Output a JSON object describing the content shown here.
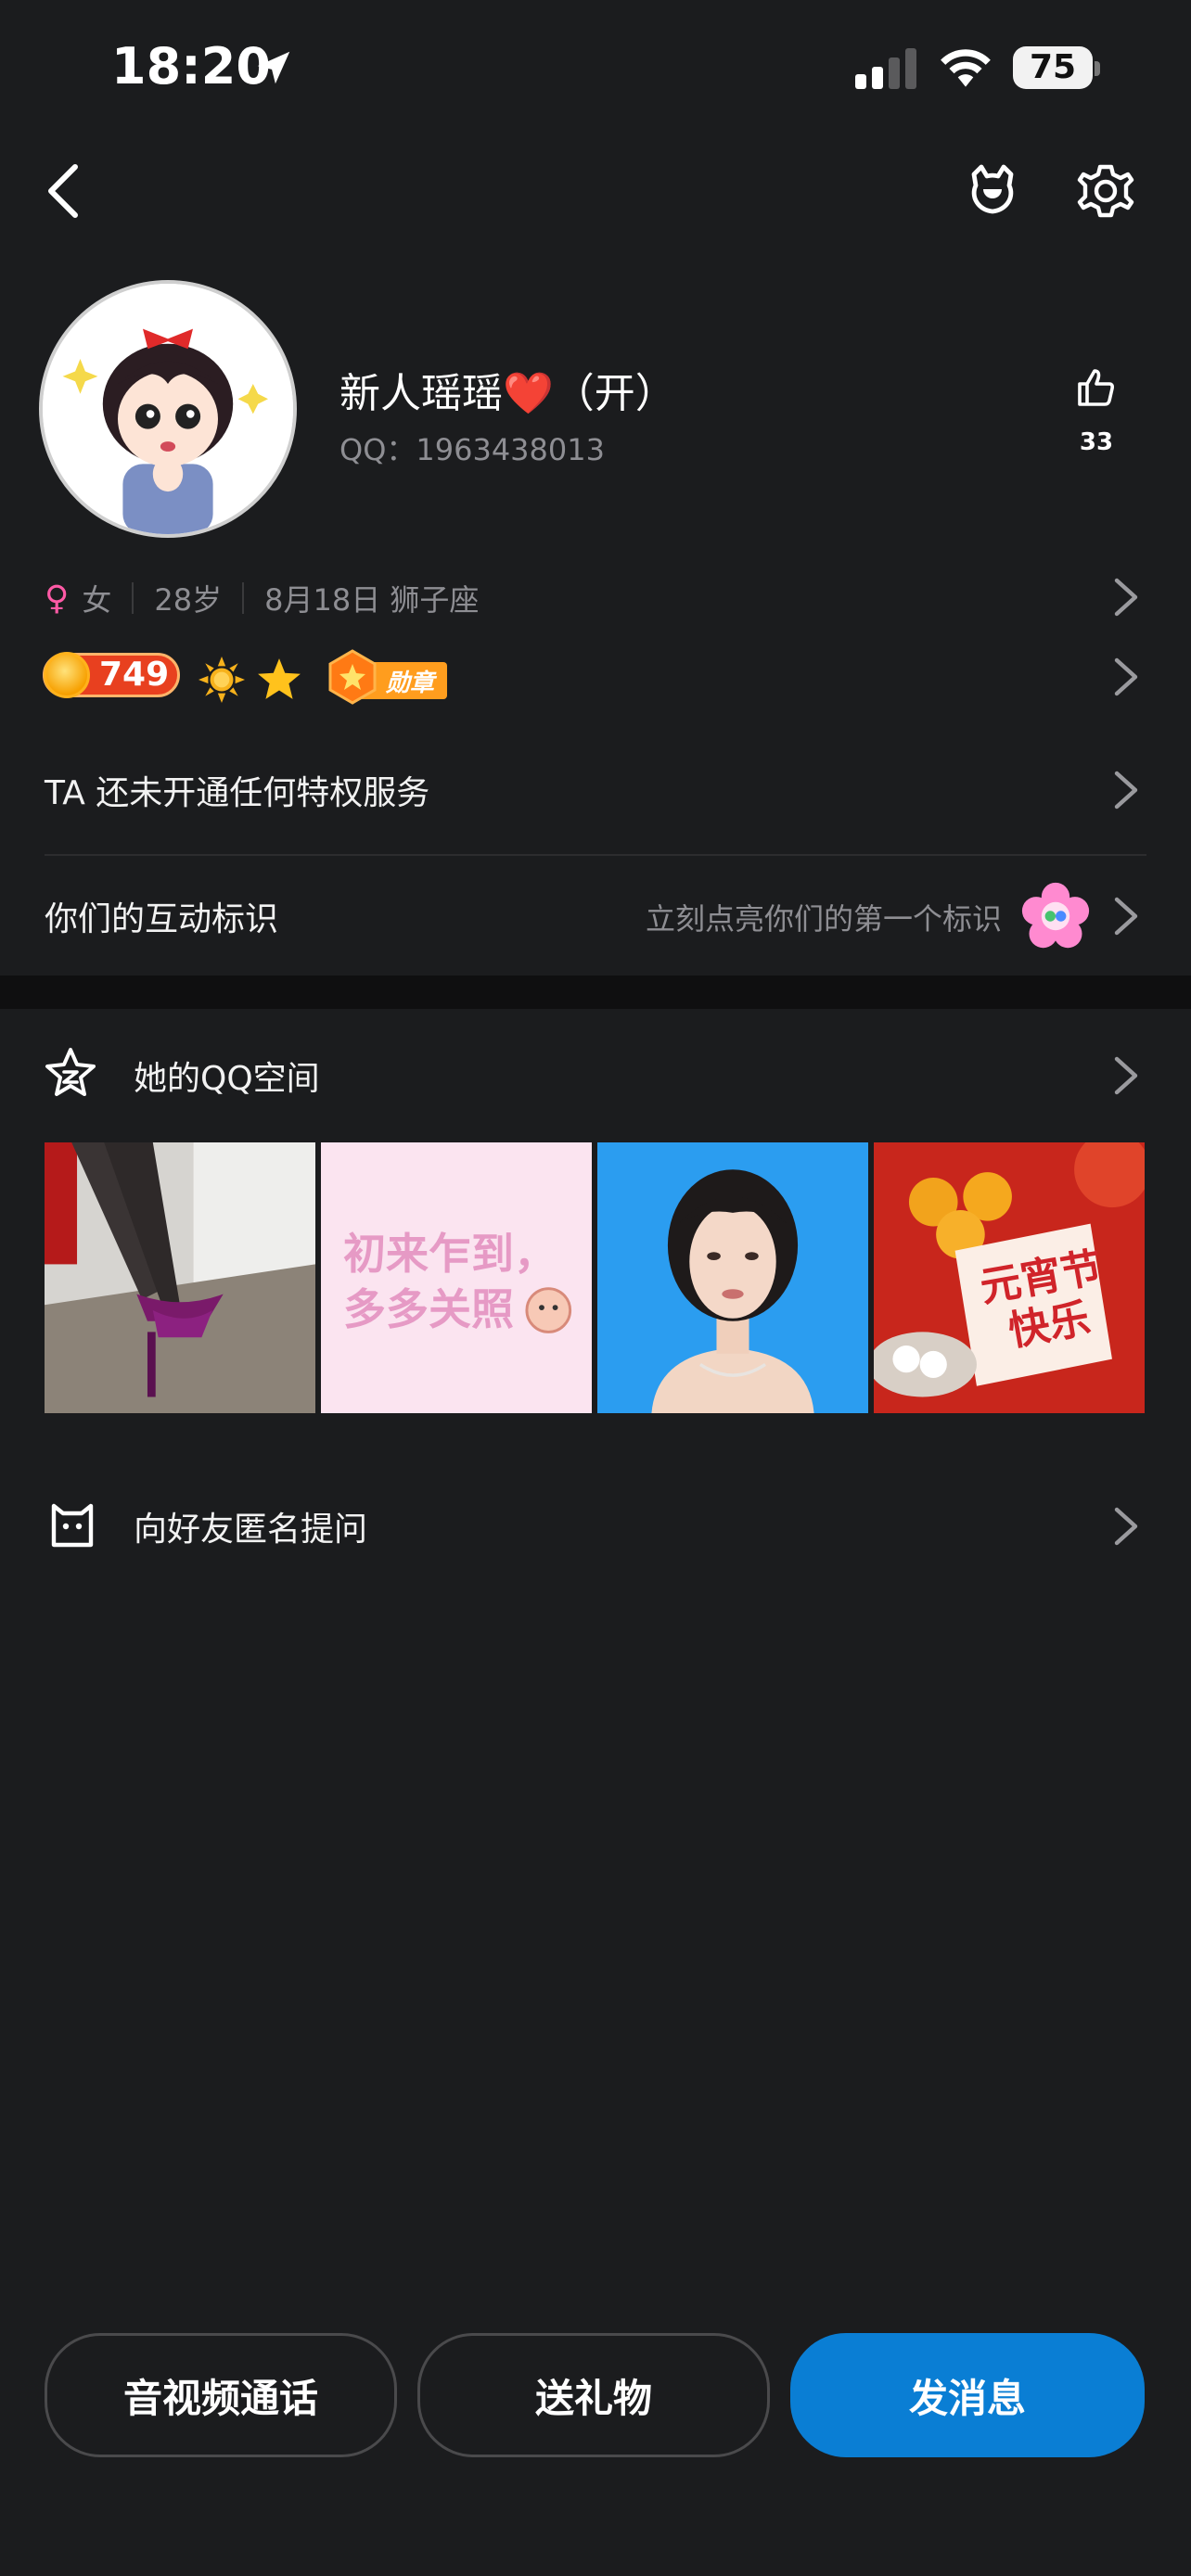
{
  "status_bar": {
    "time": "18:20",
    "battery": "75"
  },
  "profile": {
    "name": "新人瑶瑶❤️（开）",
    "qq": "QQ：1963438013",
    "likes": "33"
  },
  "info": {
    "gender": "女",
    "age": "28岁",
    "birthday": "8月18日 狮子座"
  },
  "badges": {
    "level": "749",
    "medal_label": "勋章"
  },
  "privilege_row": "TA 还未开通任何特权服务",
  "interaction_row": {
    "label": "你们的互动标识",
    "hint": "立刻点亮你们的第一个标识"
  },
  "qzone": {
    "title": "她的QQ空间",
    "photos": [
      {
        "name": "photo-heels",
        "caption": ""
      },
      {
        "name": "photo-greeting",
        "caption": "初来乍到，\n多多关照"
      },
      {
        "name": "photo-portrait",
        "caption": ""
      },
      {
        "name": "photo-lantern",
        "caption": "元宵节快乐"
      }
    ]
  },
  "ask_row": "向好友匿名提问",
  "buttons": {
    "call": "音视频通话",
    "gift": "送礼物",
    "message": "发消息"
  },
  "colors": {
    "background": "#1b1c1e",
    "primary": "#0a7ed4",
    "female": "#ff5aa6"
  }
}
